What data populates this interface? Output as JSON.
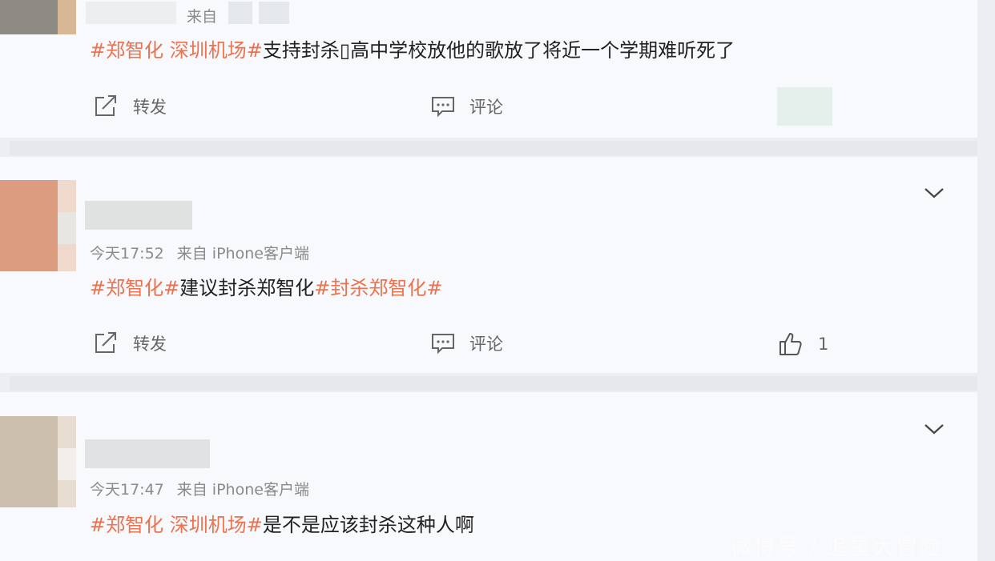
{
  "posts": [
    {
      "meta": {
        "time": "",
        "source": "来自"
      },
      "tag1": "#郑智化 深圳机场#",
      "text": "支持封杀▯高中学校放他的歌放了将近一个学期难听死了",
      "tag2": "",
      "actions": {
        "forward": "转发",
        "comment": "评论"
      }
    },
    {
      "meta": {
        "time": "今天17:52",
        "source": "来自 iPhone客户端"
      },
      "tag1": "#郑智化#",
      "text": "建议封杀郑智化",
      "tag2": "#封杀郑智化#",
      "actions": {
        "forward": "转发",
        "comment": "评论",
        "like_count": "1"
      }
    },
    {
      "meta": {
        "time": "今天17:47",
        "source": "来自 iPhone客户端"
      },
      "tag1": "#郑智化 深圳机场#",
      "text": "是不是应该封杀这种人啊",
      "tag2": ""
    }
  ],
  "watermark": "微博号 / 追星大冒险",
  "colors": {
    "tag": "#eb7350",
    "background": "#f8f9fd",
    "separator": "#e6e8ee"
  },
  "icons": [
    "forward-icon",
    "comment-icon",
    "like-icon",
    "chevron-down-icon"
  ]
}
